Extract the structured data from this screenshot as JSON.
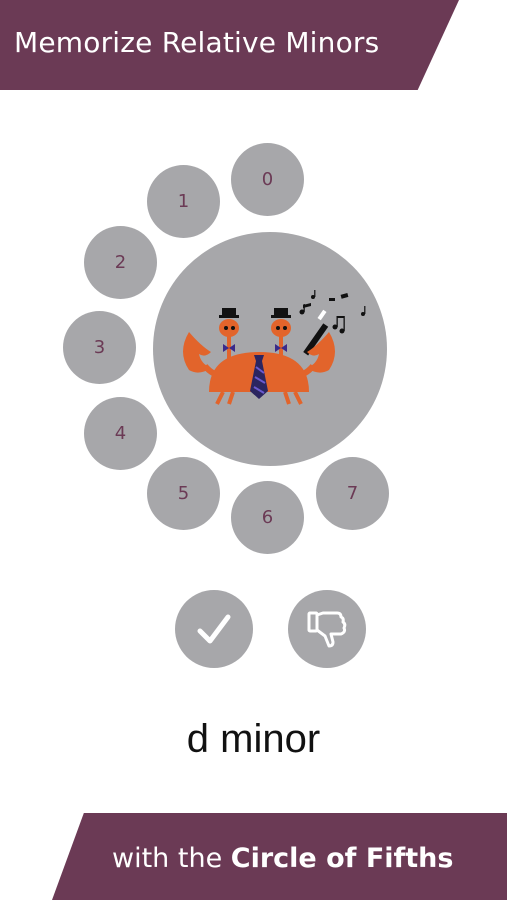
{
  "header": {
    "title": "Memorize Relative Minors"
  },
  "wheel": {
    "numbers": [
      "0",
      "1",
      "2",
      "3",
      "4",
      "5",
      "6",
      "7"
    ]
  },
  "mascot": {
    "icon": "crab-conductor-icon"
  },
  "actions": {
    "correct_icon": "checkmark-icon",
    "wrong_icon": "thumbs-down-icon"
  },
  "question": {
    "label": "d minor"
  },
  "footer": {
    "prefix": "with the ",
    "emphasis": "Circle of Fifths"
  },
  "colors": {
    "brand": "#6b3a55",
    "circle": "#a7a7aa",
    "crab": "#e2642b"
  }
}
